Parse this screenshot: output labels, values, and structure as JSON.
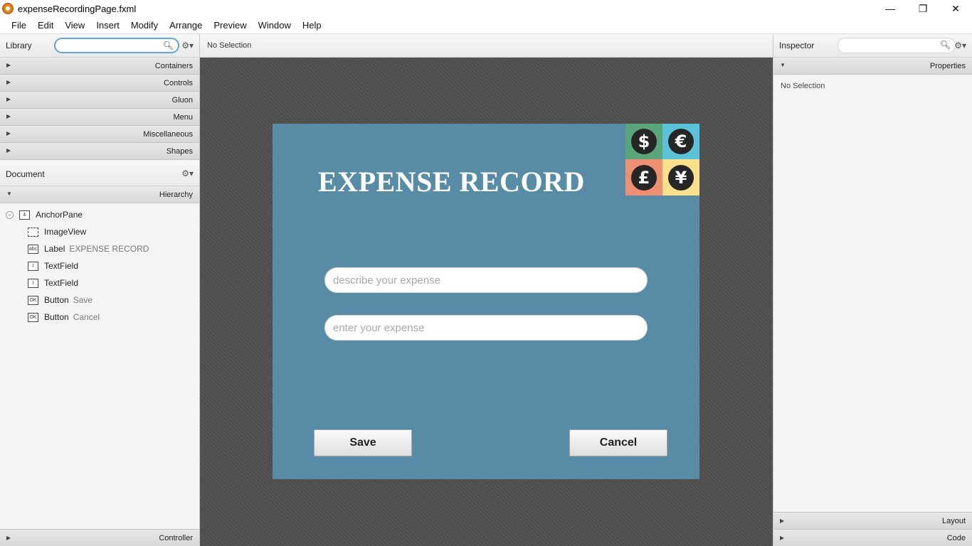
{
  "window": {
    "title": "expenseRecordingPage.fxml",
    "minimize": "—",
    "restore": "❐",
    "close": "✕"
  },
  "menu": [
    "File",
    "Edit",
    "View",
    "Insert",
    "Modify",
    "Arrange",
    "Preview",
    "Window",
    "Help"
  ],
  "library": {
    "title": "Library",
    "search_value": "",
    "sections": [
      "Containers",
      "Controls",
      "Gluon",
      "Menu",
      "Miscellaneous",
      "Shapes"
    ]
  },
  "document": {
    "title": "Document",
    "hierarchy_label": "Hierarchy",
    "tree": [
      {
        "icon": "anchor-icon",
        "label": "AnchorPane",
        "sub": ""
      },
      {
        "icon": "imageview-icon",
        "label": "ImageView",
        "sub": ""
      },
      {
        "icon": "label-icon",
        "label": "Label",
        "sub": "EXPENSE RECORD"
      },
      {
        "icon": "textfield-icon",
        "label": "TextField",
        "sub": ""
      },
      {
        "icon": "textfield-icon",
        "label": "TextField",
        "sub": ""
      },
      {
        "icon": "button-icon",
        "label": "Button",
        "sub": "Save"
      },
      {
        "icon": "button-icon",
        "label": "Button",
        "sub": "Cancel"
      }
    ],
    "controller_label": "Controller"
  },
  "center": {
    "selection_text": "No Selection"
  },
  "design": {
    "title": "EXPENSE RECORD",
    "description_placeholder": "describe your expense",
    "amount_placeholder": "enter your expense",
    "save_label": "Save",
    "cancel_label": "Cancel",
    "currencies": [
      {
        "symbol": "$",
        "bg": "#5aa57a"
      },
      {
        "symbol": "€",
        "bg": "#5bc2d9"
      },
      {
        "symbol": "£",
        "bg": "#ef8f72"
      },
      {
        "symbol": "¥",
        "bg": "#fbe08c"
      }
    ]
  },
  "inspector": {
    "title": "Inspector",
    "search_value": "",
    "properties_label": "Properties",
    "selection_text": "No Selection",
    "layout_label": "Layout",
    "code_label": "Code"
  },
  "colors": {
    "design_bg": "#588ca6",
    "canvas_bg": "#4d4d4d",
    "focus_ring": "#60a6d9"
  }
}
